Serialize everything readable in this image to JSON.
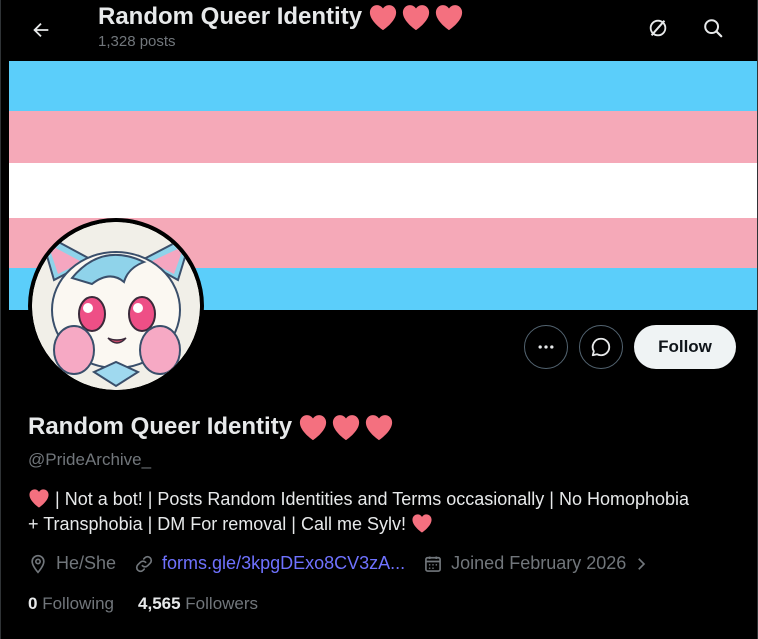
{
  "header": {
    "title": "Random Queer Identity",
    "post_count": "1,328 posts"
  },
  "colors": {
    "heart": "#f4707f",
    "flag_blue": "#5bcefa",
    "flag_pink": "#f5a9b8",
    "flag_white": "#ffffff",
    "link": "#6f72ff"
  },
  "actions": {
    "follow_label": "Follow"
  },
  "profile": {
    "name": "Random Queer Identity",
    "handle": "@PrideArchive_",
    "bio_line1": "| Not a bot! | Posts Random Identities and Terms occasionally | No Homophobia",
    "bio_line2": "+ Transphobia | DM For removal | Call me Sylv!",
    "pronouns": "He/She",
    "link": "forms.gle/3kpgDExo8CV3zA...",
    "joined": "Joined February 2026"
  },
  "stats": {
    "following_count": "0",
    "following_label": "Following",
    "followers_count": "4,565",
    "followers_label": "Followers"
  },
  "icons": [
    "back-arrow-icon",
    "grok-icon",
    "search-icon",
    "more-icon",
    "message-icon",
    "location-icon",
    "link-icon",
    "calendar-icon",
    "chevron-right-icon",
    "heart-icon"
  ]
}
